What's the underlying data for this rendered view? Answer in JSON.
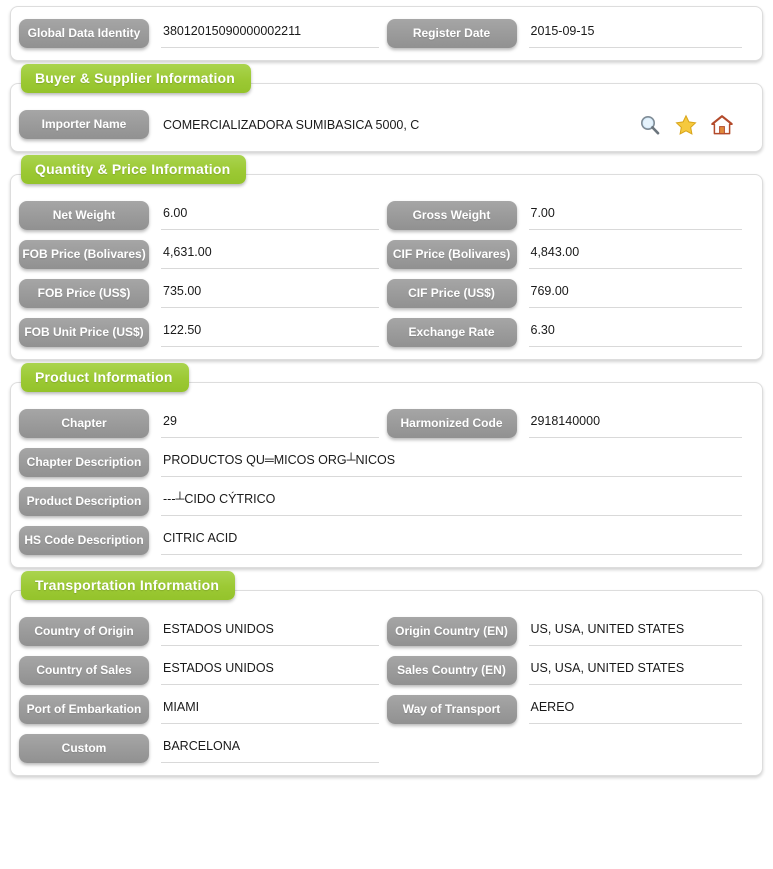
{
  "theme": {
    "section_green": "#a2ce3e",
    "label_gray": "#9a9a9a",
    "card_bg": "#ffffff",
    "value_text": "#1a1a1a",
    "underline": "#d9d9d9"
  },
  "sections": {
    "identity": {
      "fields": {
        "global_data_identity_label": "Global Data Identity",
        "global_data_identity_value": "38012015090000002211",
        "register_date_label": "Register Date",
        "register_date_value": "2015-09-15"
      }
    },
    "buyer_supplier": {
      "title": "Buyer & Supplier Information",
      "fields": {
        "importer_name_label": "Importer Name",
        "importer_name_value": "COMERCIALIZADORA SUMIBASICA 5000, C"
      },
      "icons": [
        {
          "name": "search-icon",
          "title": "Search"
        },
        {
          "name": "star-icon",
          "title": "Favorite"
        },
        {
          "name": "home-icon",
          "title": "Home"
        }
      ]
    },
    "quantity_price": {
      "title": "Quantity & Price Information",
      "fields": {
        "net_weight_label": "Net Weight",
        "net_weight_value": "6.00",
        "gross_weight_label": "Gross Weight",
        "gross_weight_value": "7.00",
        "fob_price_bolivares_label": "FOB Price (Bolivares)",
        "fob_price_bolivares_value": "4,631.00",
        "cif_price_bolivares_label": "CIF Price (Bolivares)",
        "cif_price_bolivares_value": "4,843.00",
        "fob_price_usd_label": "FOB Price (US$)",
        "fob_price_usd_value": "735.00",
        "cif_price_usd_label": "CIF Price (US$)",
        "cif_price_usd_value": "769.00",
        "fob_unit_price_usd_label": "FOB Unit Price (US$)",
        "fob_unit_price_usd_value": "122.50",
        "exchange_rate_label": "Exchange Rate",
        "exchange_rate_value": "6.30"
      }
    },
    "product": {
      "title": "Product Information",
      "fields": {
        "chapter_label": "Chapter",
        "chapter_value": "29",
        "harmonized_code_label": "Harmonized Code",
        "harmonized_code_value": "2918140000",
        "chapter_description_label": "Chapter Description",
        "chapter_description_value": "PRODUCTOS QU═MICOS ORG┴NICOS",
        "product_description_label": "Product Description",
        "product_description_value": "---┴CIDO CÝTRICO",
        "hs_code_description_label": "HS Code Description",
        "hs_code_description_value": "CITRIC ACID"
      }
    },
    "transportation": {
      "title": "Transportation Information",
      "fields": {
        "country_of_origin_label": "Country of Origin",
        "country_of_origin_value": "ESTADOS UNIDOS",
        "origin_country_en_label": "Origin Country (EN)",
        "origin_country_en_value": "US, USA, UNITED STATES",
        "country_of_sales_label": "Country of Sales",
        "country_of_sales_value": "ESTADOS UNIDOS",
        "sales_country_en_label": "Sales Country (EN)",
        "sales_country_en_value": "US, USA, UNITED STATES",
        "port_of_embarkation_label": "Port of Embarkation",
        "port_of_embarkation_value": "MIAMI",
        "way_of_transport_label": "Way of Transport",
        "way_of_transport_value": "AEREO",
        "custom_label": "Custom",
        "custom_value": "BARCELONA"
      }
    }
  }
}
